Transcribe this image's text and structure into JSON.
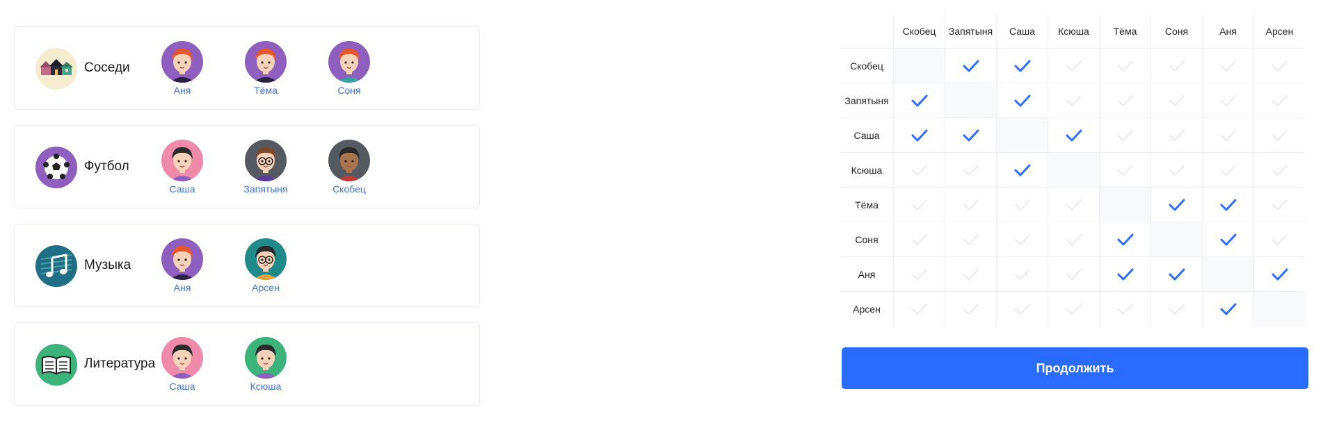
{
  "groups": [
    {
      "name": "Соседи",
      "icon": "houses-icon",
      "icon_bg": "#f6ecd0",
      "members": [
        {
          "name": "Аня",
          "avatar": "avatar-anya",
          "bg": "#8f5fbf"
        },
        {
          "name": "Тёма",
          "avatar": "avatar-tyoma",
          "bg": "#8f5fbf"
        },
        {
          "name": "Соня",
          "avatar": "avatar-sonya",
          "bg": "#8f5fbf"
        }
      ]
    },
    {
      "name": "Футбол",
      "icon": "soccer-ball-icon",
      "icon_bg": "#8f5fbf",
      "members": [
        {
          "name": "Саша",
          "avatar": "avatar-sasha",
          "bg": "#f08aab"
        },
        {
          "name": "Запятыня",
          "avatar": "avatar-zapyatynya",
          "bg": "#555a60"
        },
        {
          "name": "Скобец",
          "avatar": "avatar-skobets",
          "bg": "#555a60"
        }
      ]
    },
    {
      "name": "Музыка",
      "icon": "music-note-icon",
      "icon_bg": "#1f6e86",
      "members": [
        {
          "name": "Аня",
          "avatar": "avatar-anya",
          "bg": "#8f5fbf"
        },
        {
          "name": "Арсен",
          "avatar": "avatar-arsen",
          "bg": "#1f8a8a"
        }
      ]
    },
    {
      "name": "Литература",
      "icon": "open-book-icon",
      "icon_bg": "#3bb37a",
      "members": [
        {
          "name": "Саша",
          "avatar": "avatar-sasha",
          "bg": "#f08aab"
        },
        {
          "name": "Ксюша",
          "avatar": "avatar-ksyusha",
          "bg": "#3bb37a"
        }
      ]
    }
  ],
  "matrix": {
    "names": [
      "Скобец",
      "Запятыня",
      "Саша",
      "Ксюша",
      "Тёма",
      "Соня",
      "Аня",
      "Арсен"
    ],
    "checked": [
      [
        0,
        1,
        1,
        0,
        0,
        0,
        0,
        0
      ],
      [
        1,
        0,
        1,
        0,
        0,
        0,
        0,
        0
      ],
      [
        1,
        1,
        0,
        1,
        0,
        0,
        0,
        0
      ],
      [
        0,
        0,
        1,
        0,
        0,
        0,
        0,
        0
      ],
      [
        0,
        0,
        0,
        0,
        0,
        1,
        1,
        0
      ],
      [
        0,
        0,
        0,
        0,
        1,
        0,
        1,
        0
      ],
      [
        0,
        0,
        0,
        0,
        1,
        1,
        0,
        1
      ],
      [
        0,
        0,
        0,
        0,
        0,
        0,
        1,
        0
      ]
    ],
    "check_color_on": "#2a6cff",
    "check_color_off": "#e3e6ea"
  },
  "continue_label": "Продолжить",
  "accent": "#2a6cff"
}
